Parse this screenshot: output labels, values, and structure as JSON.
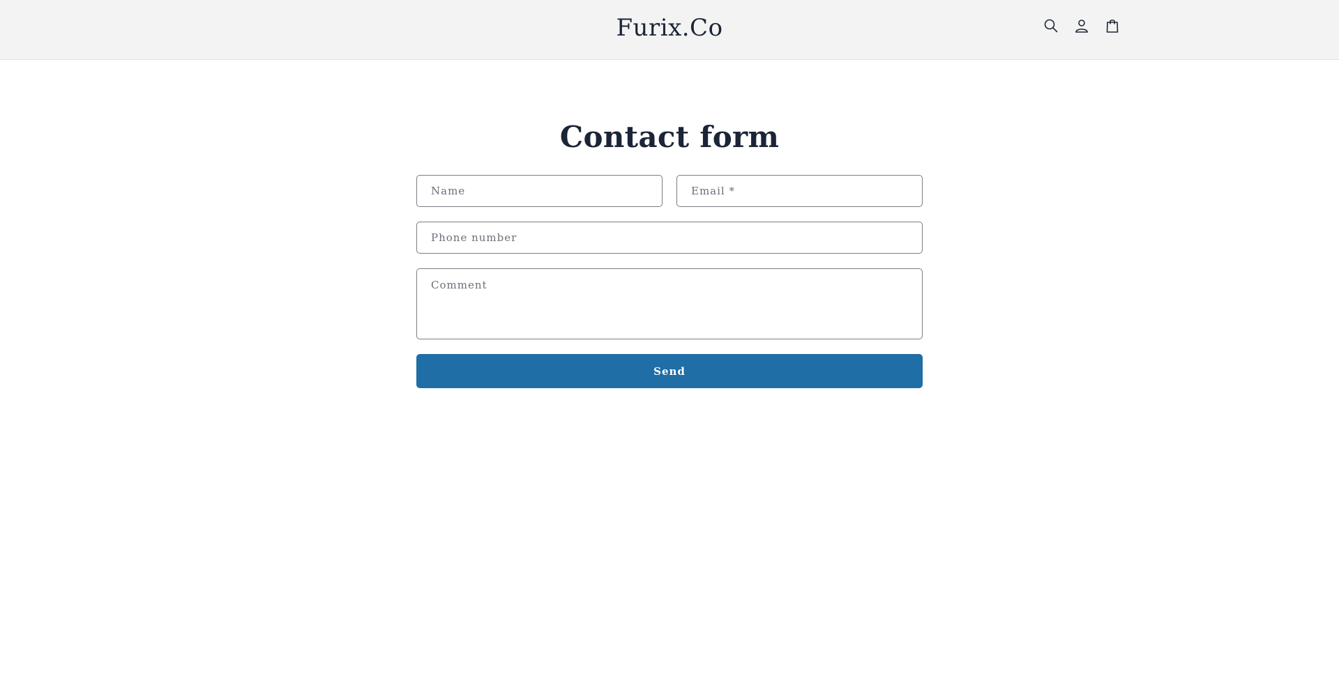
{
  "header": {
    "brand": "Furix.Co",
    "icons": [
      "search-icon",
      "account-icon",
      "cart-icon"
    ]
  },
  "main": {
    "title": "Contact form",
    "form": {
      "name_placeholder": "Name",
      "email_placeholder": "Email *",
      "phone_placeholder": "Phone number",
      "comment_placeholder": "Comment",
      "send_label": "Send"
    }
  },
  "colors": {
    "header_bg": "#f3f3f3",
    "text": "#1c2537",
    "accent": "#1f6ea6",
    "field_border": "#7a7d85"
  }
}
